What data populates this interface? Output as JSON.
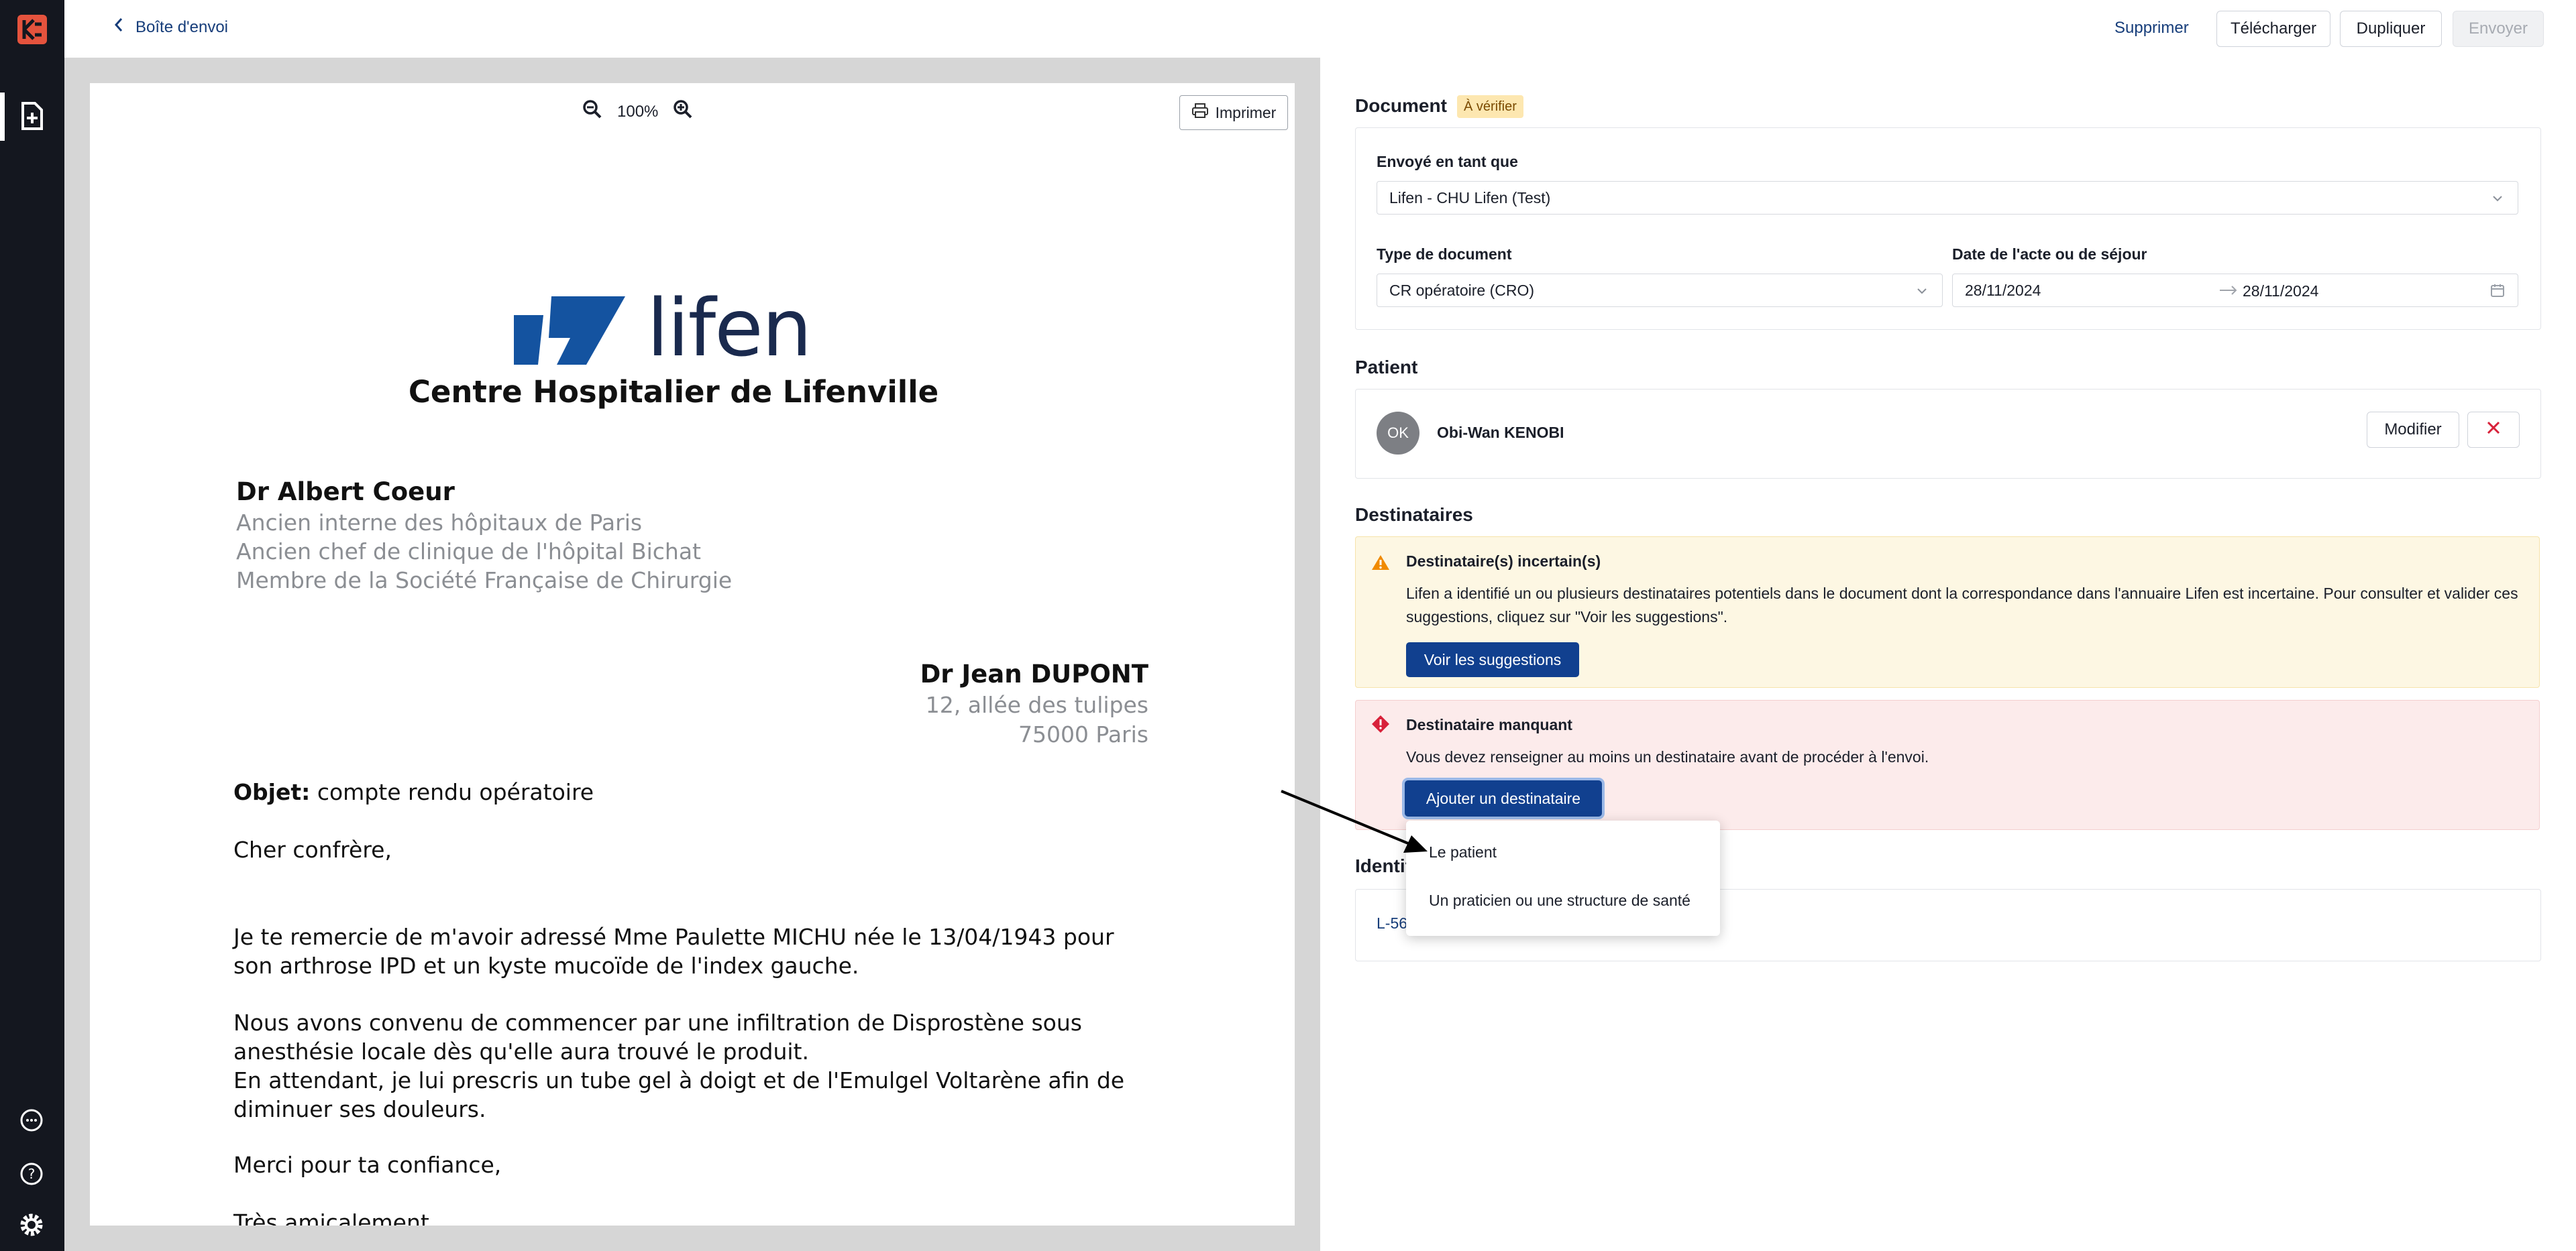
{
  "back_link": "Boîte d'envoi",
  "toolbar": {
    "delete": "Supprimer",
    "download": "Télécharger",
    "duplicate": "Dupliquer",
    "send": "Envoyer"
  },
  "viewer": {
    "zoom": "100%",
    "print": "Imprimer"
  },
  "letter": {
    "logo_text": "lifen",
    "hospital": "Centre Hospitalier de Lifenville",
    "sender_name": "Dr Albert Coeur",
    "sender_lines": [
      "Ancien interne des hôpitaux de Paris",
      "Ancien chef de clinique de l'hôpital Bichat",
      "Membre de la Société Française de Chirurgie"
    ],
    "recipient_name": "Dr Jean DUPONT",
    "recipient_street": "12, allée des tulipes",
    "recipient_city": "75000 Paris",
    "subject_label": "Objet:",
    "subject": "compte rendu opératoire",
    "greeting": "Cher confrère,",
    "para1": "Je te remercie de m'avoir adressé Mme Paulette MICHU née le 13/04/1943 pour son arthrose IPD et un kyste mucoïde de l'index gauche.",
    "para2a": "Nous avons convenu de commencer par une infiltration de Disprostène sous anesthésie locale dès qu'elle aura trouvé le produit.",
    "para2b": "En attendant, je lui prescris un tube gel à doigt et de l'Emulgel Voltarène afin de diminuer ses douleurs.",
    "thanks": "Merci pour ta confiance,",
    "closing": "Très amicalement,"
  },
  "document": {
    "title": "Document",
    "badge": "À vérifier",
    "sent_as_label": "Envoyé en tant que",
    "sent_as_value": "Lifen - CHU Lifen (Test)",
    "doc_type_label": "Type de document",
    "doc_type_value": "CR opératoire (CRO)",
    "date_label": "Date de l'acte ou de séjour",
    "date_start": "28/11/2024",
    "date_end": "28/11/2024"
  },
  "patient": {
    "title": "Patient",
    "initials": "OK",
    "name": "Obi-Wan KENOBI",
    "modify": "Modifier"
  },
  "recipients": {
    "title": "Destinataires",
    "warning_title": "Destinataire(s) incertain(s)",
    "warning_text": "Lifen a identifié un ou plusieurs destinataires potentiels dans le document dont la correspondance dans l'annuaire Lifen est incertaine. Pour consulter et valider ces suggestions, cliquez sur \"Voir les suggestions\".",
    "warning_button": "Voir les suggestions",
    "error_title": "Destinataire manquant",
    "error_text": "Vous devez renseigner au moins un destinataire avant de procéder à l'envoi.",
    "add_button": "Ajouter un destinataire",
    "menu": [
      "Le patient",
      "Un praticien ou une structure de santé"
    ]
  },
  "identifiers": {
    "title_visible": "Identif",
    "value_visible": "L-56"
  },
  "colors": {
    "rail": "#14171f",
    "primary": "#11408f",
    "warning_bg": "#fdf7e3",
    "error_bg": "#fcebeb",
    "badge_bg": "#fde7b0"
  }
}
